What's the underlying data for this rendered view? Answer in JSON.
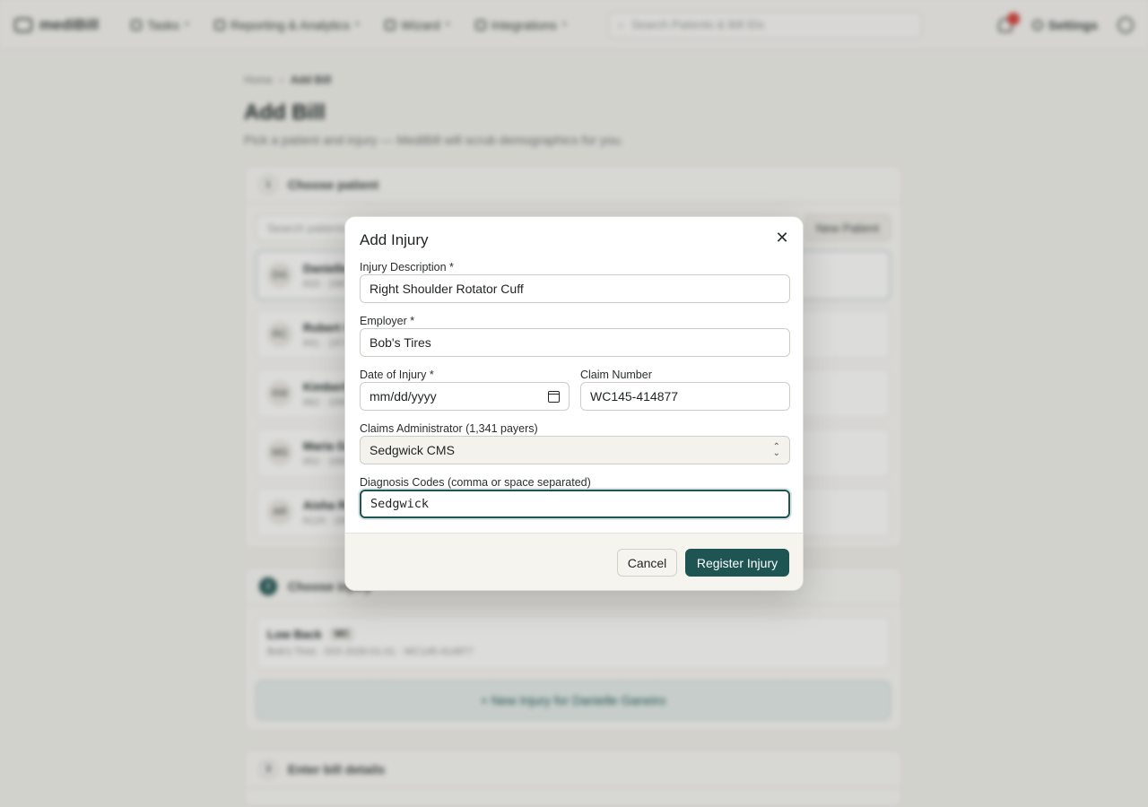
{
  "app": {
    "brand": "mediBill",
    "nav": [
      {
        "label": "Tasks"
      },
      {
        "label": "Reporting & Analytics"
      },
      {
        "label": "Wizard"
      },
      {
        "label": "Integrations"
      }
    ],
    "search_placeholder": "Search Patients & Bill IDs",
    "settings_label": "Settings"
  },
  "page": {
    "breadcrumb": [
      "Home",
      "Add Bill"
    ],
    "title": "Add Bill",
    "subtitle": "Pick a patient and injury — MediBill will scrub demographics for you.",
    "step1": {
      "title": "Choose patient",
      "search_placeholder": "Search patients",
      "new_button": "New Patient",
      "patients": [
        {
          "initials": "DG",
          "name": "Danielle Ganeiro",
          "meta": "833 · 1987-08-12"
        },
        {
          "initials": "RC",
          "name": "Robert Cole",
          "meta": "841 · 1974-03-27"
        },
        {
          "initials": "KM",
          "name": "Kimberly Moss",
          "meta": "862 · 1990-11-05"
        },
        {
          "initials": "MG",
          "name": "Maria Gomez",
          "meta": "852 · 1969-07-19"
        },
        {
          "initials": "AR",
          "name": "Aisha Rahman",
          "meta": "8124 · 1982-02-14"
        }
      ]
    },
    "step2": {
      "title": "Choose injury",
      "injury": {
        "name": "Low Back",
        "tag": "WC",
        "meta": "Bob's Tires · DOI 2026-01-01 · WC145-414877"
      },
      "new_injury": "+ New Injury for Danielle Ganeiro"
    },
    "step3": {
      "title": "Enter bill details"
    }
  },
  "modal": {
    "title": "Add Injury",
    "injury_description": {
      "label": "Injury Description *",
      "value": "Right Shoulder Rotator Cuff"
    },
    "employer": {
      "label": "Employer *",
      "value": "Bob's Tires"
    },
    "date_of_injury": {
      "label": "Date of Injury *",
      "placeholder": "mm/dd/yyyy"
    },
    "claim_number": {
      "label": "Claim Number",
      "value": "WC145-414877"
    },
    "claims_administrator": {
      "label": "Claims Administrator (1,341 payers)",
      "value": "Sedgwick CMS"
    },
    "diagnosis_codes": {
      "label": "Diagnosis Codes (comma or space separated)",
      "value": "Sedgwick"
    },
    "cancel_label": "Cancel",
    "submit_label": "Register Injury"
  },
  "icons": {
    "close": "close-icon",
    "calendar": "calendar-icon",
    "select": "chevron-up-down-icon"
  },
  "colors": {
    "primary": "#1e5552",
    "backdrop": "#f4f3ef"
  }
}
